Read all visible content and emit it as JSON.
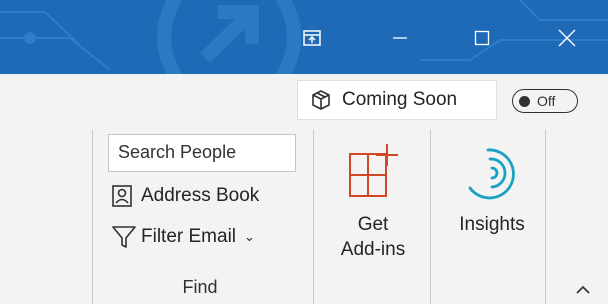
{
  "titlebar": {
    "bg_color": "#1e6ab6",
    "buttons": [
      {
        "icon": "ribbon-display-options-icon"
      },
      {
        "icon": "minimize-icon"
      },
      {
        "icon": "maximize-icon"
      },
      {
        "icon": "close-icon"
      }
    ]
  },
  "ribbon": {
    "coming_soon": {
      "label": "Coming Soon",
      "icon": "gift-box-icon"
    },
    "toggle": {
      "label": "Off",
      "state": "off"
    },
    "find_group": {
      "search_placeholder": "Search People",
      "address_book_label": "Address Book",
      "filter_email_label": "Filter Email",
      "group_label": "Find"
    },
    "get_addins": {
      "line1": "Get",
      "line2": "Add-ins",
      "icon_color": "#d24726"
    },
    "insights": {
      "label": "Insights",
      "icon_color": "#1aa1c2"
    }
  }
}
